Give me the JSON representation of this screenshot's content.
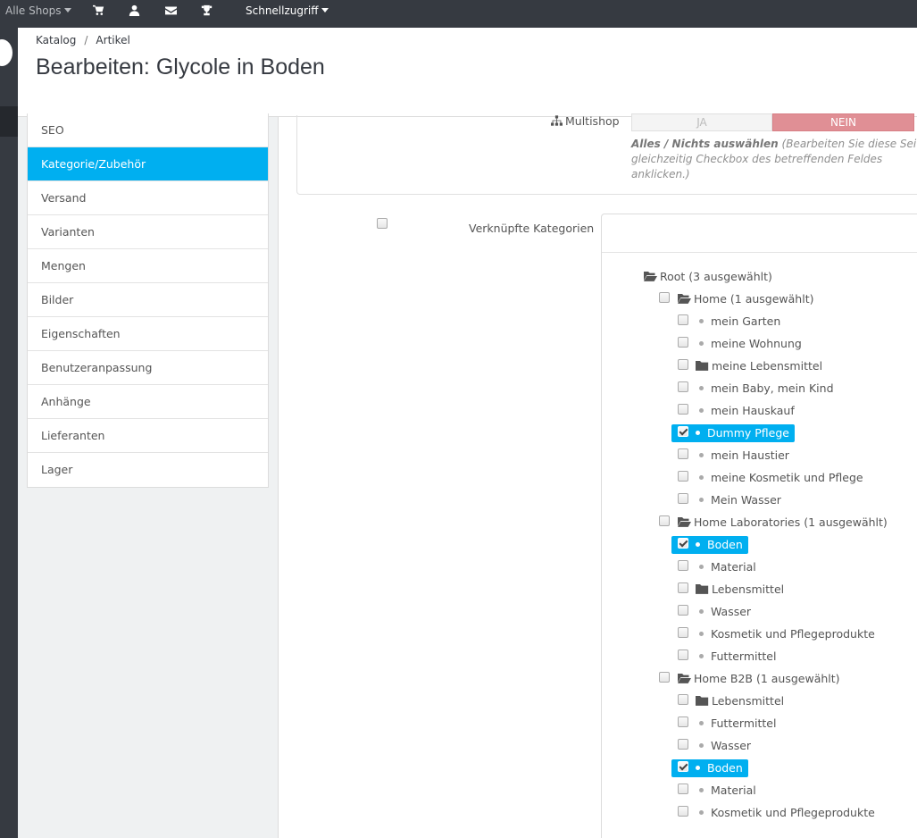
{
  "topbar": {
    "shops_label": "Alle Shops",
    "quick_access_label": "Schnellzugriff",
    "icons": [
      "cart-icon",
      "user-icon",
      "envelope-icon",
      "trophy-icon"
    ]
  },
  "breadcrumb": {
    "first": "Katalog",
    "separator": "/",
    "second": "Artikel"
  },
  "page_title": "Bearbeiten: Glycole in Boden",
  "tabs": [
    {
      "label": "SEO"
    },
    {
      "label": "Kategorie/Zubehör"
    },
    {
      "label": "Versand"
    },
    {
      "label": "Varianten"
    },
    {
      "label": "Mengen"
    },
    {
      "label": "Bilder"
    },
    {
      "label": "Eigenschaften"
    },
    {
      "label": "Benutzeranpassung"
    },
    {
      "label": "Anhänge"
    },
    {
      "label": "Lieferanten"
    },
    {
      "label": "Lager"
    }
  ],
  "active_tab": "Kategorie/Zubehör",
  "multishop": {
    "label": "Multishop",
    "yes": "JA",
    "no": "NEIN",
    "help_bold": "Alles / Nichts auswählen",
    "help_text": " (Bearbeiten Sie diese Seite gleichzeitig Checkbox des betreffenden Feldes anklicken.)"
  },
  "categories": {
    "label": "Verknüpfte Kategorien",
    "tree": [
      {
        "label": "Root (3 ausgewählt)",
        "type": "folder-open",
        "level": 0
      },
      {
        "label": "Home (1 ausgewählt)",
        "type": "folder-open",
        "level": 1
      },
      {
        "label": "mein Garten",
        "type": "leaf",
        "level": 2
      },
      {
        "label": "meine Wohnung",
        "type": "leaf",
        "level": 2
      },
      {
        "label": "meine Lebensmittel",
        "type": "folder",
        "level": 2
      },
      {
        "label": "mein Baby, mein Kind",
        "type": "leaf",
        "level": 2
      },
      {
        "label": "mein Hauskauf",
        "type": "leaf",
        "level": 2
      },
      {
        "label": "Dummy Pflege",
        "type": "leaf",
        "level": 2,
        "checked": true
      },
      {
        "label": "mein Haustier",
        "type": "leaf",
        "level": 2
      },
      {
        "label": "meine Kosmetik und Pflege",
        "type": "leaf",
        "level": 2
      },
      {
        "label": "Mein Wasser",
        "type": "leaf",
        "level": 2
      },
      {
        "label": "Home Laboratories (1 ausgewählt)",
        "type": "folder-open",
        "level": 1
      },
      {
        "label": "Boden",
        "type": "leaf",
        "level": 2,
        "checked": true
      },
      {
        "label": "Material",
        "type": "leaf",
        "level": 2
      },
      {
        "label": "Lebensmittel",
        "type": "folder",
        "level": 2
      },
      {
        "label": "Wasser",
        "type": "leaf",
        "level": 2
      },
      {
        "label": "Kosmetik und Pflegeprodukte",
        "type": "leaf",
        "level": 2
      },
      {
        "label": "Futtermittel",
        "type": "leaf",
        "level": 2
      },
      {
        "label": "Home B2B (1 ausgewählt)",
        "type": "folder-open",
        "level": 1
      },
      {
        "label": "Lebensmittel",
        "type": "folder",
        "level": 2
      },
      {
        "label": "Futtermittel",
        "type": "leaf",
        "level": 2
      },
      {
        "label": "Wasser",
        "type": "leaf",
        "level": 2
      },
      {
        "label": "Boden",
        "type": "leaf",
        "level": 2,
        "checked": true
      },
      {
        "label": "Material",
        "type": "leaf",
        "level": 2
      },
      {
        "label": "Kosmetik und Pflegeprodukte",
        "type": "leaf",
        "level": 2
      }
    ]
  },
  "colors": {
    "accent": "#00aff0",
    "topbar": "#363a41",
    "toggle_no": "#e08f95"
  }
}
